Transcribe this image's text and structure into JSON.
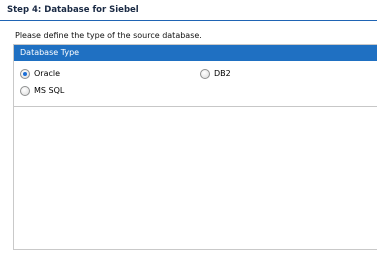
{
  "step": {
    "title": "Step 4:  Database for Siebel"
  },
  "instruction": "Please define the type of the source database.",
  "panel": {
    "header": "Database Type",
    "options": [
      {
        "label": "Oracle",
        "selected": true
      },
      {
        "label": "DB2",
        "selected": false
      },
      {
        "label": "MS SQL",
        "selected": false
      }
    ]
  },
  "colors": {
    "accent": "#1f70c2",
    "header_rule": "#1f64b4"
  }
}
